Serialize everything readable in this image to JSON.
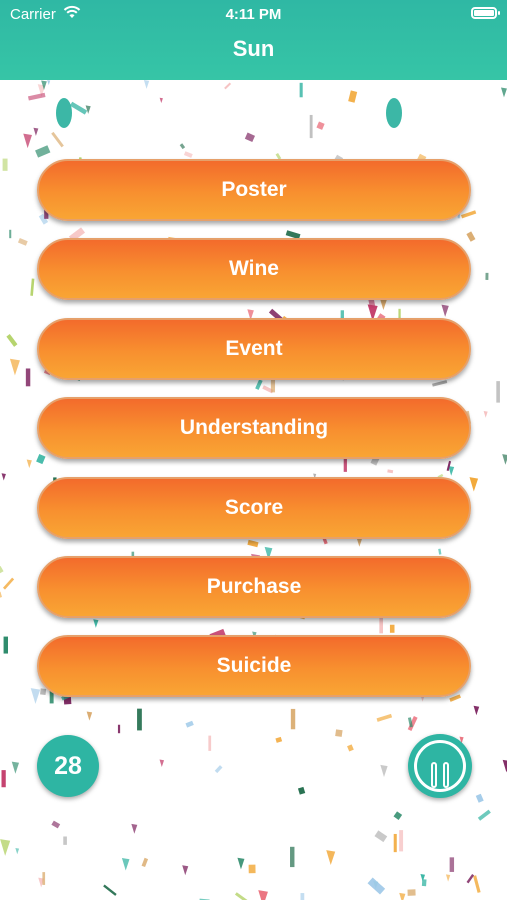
{
  "status_bar": {
    "carrier": "Carrier",
    "time": "4:11 PM"
  },
  "header": {
    "title": "Sun"
  },
  "options": [
    "Poster",
    "Wine",
    "Event",
    "Understanding",
    "Score",
    "Purchase",
    "Suicide"
  ],
  "counter": "28",
  "colors": {
    "header": "#2fb8a4",
    "button_top": "#f36b2c",
    "button_bottom": "#f9a534",
    "accent": "#2eb5a3"
  },
  "icons": {
    "wifi": "wifi-icon",
    "battery": "battery-icon",
    "pause": "pause-icon"
  }
}
